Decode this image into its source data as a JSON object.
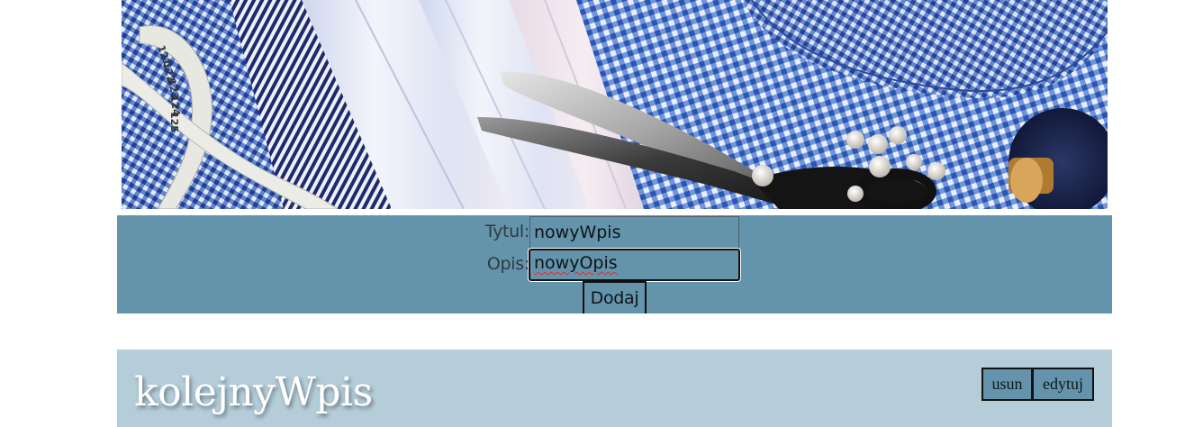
{
  "form": {
    "title_label": "Tytul:",
    "title_value": "nowyWpis",
    "description_label": "Opis:",
    "description_value": "nowyOpis",
    "add_button": "Dodaj"
  },
  "entries": [
    {
      "title": "kolejnyWpis",
      "delete_label": "usun",
      "edit_label": "edytuj"
    }
  ],
  "banner": {
    "description_icon": "banner-photo",
    "measuring_tape_numbers": [
      "121",
      "122",
      "123",
      "124",
      "125"
    ]
  },
  "colors": {
    "form_background": "#6494ac",
    "entry_background": "#b4cdd8",
    "entry_title": "#ffffff"
  }
}
